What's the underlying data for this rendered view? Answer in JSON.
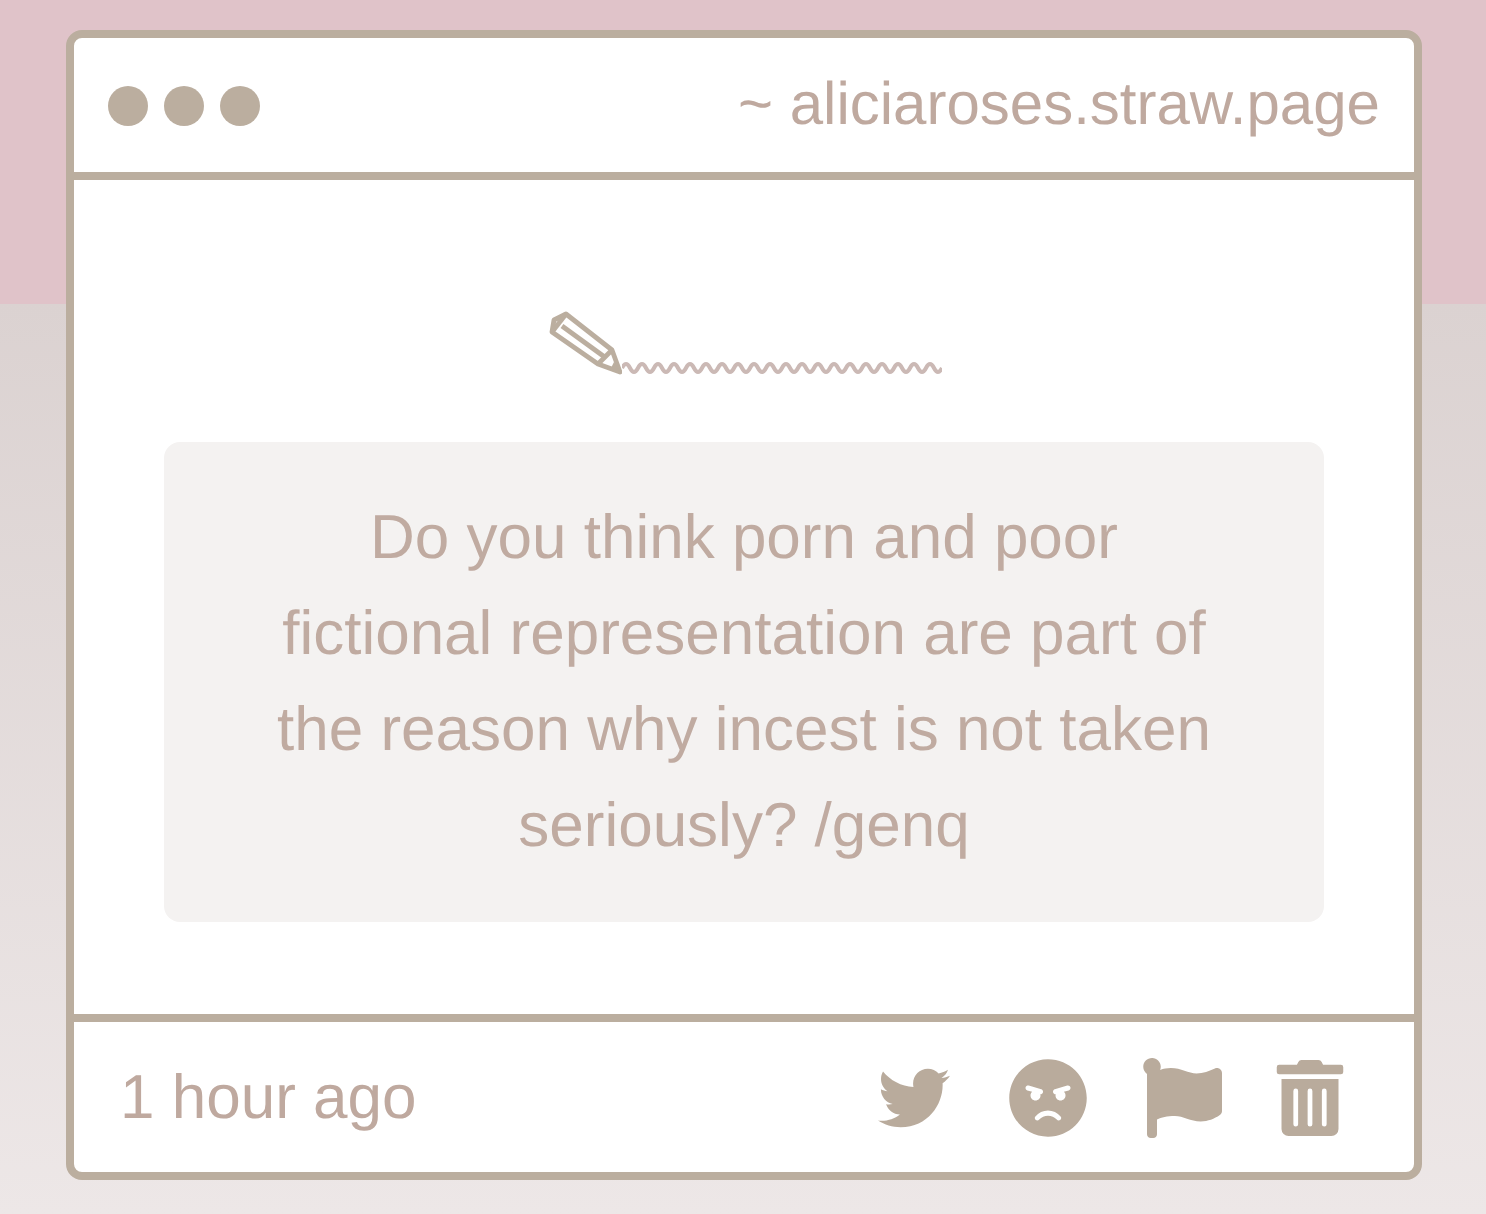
{
  "window": {
    "title": "~ aliciaroses.straw.page"
  },
  "question": {
    "text": "Do you think porn and poor fictional representation are part of the reason why incest is not taken seriously? /genq"
  },
  "footer": {
    "time": "1 hour ago",
    "actions": [
      {
        "kind": "bird"
      },
      {
        "kind": "angry"
      },
      {
        "kind": "flag"
      },
      {
        "kind": "trash"
      }
    ]
  }
}
